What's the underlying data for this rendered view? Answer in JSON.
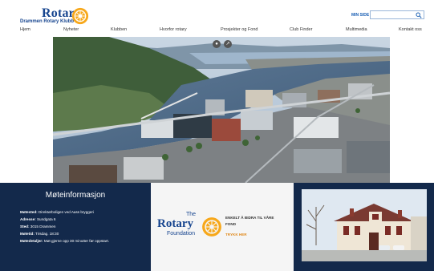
{
  "header": {
    "logo_word": "Rotary",
    "logo_club": "Drammen Rotary Klubb",
    "minside_label": "MIN SIDE",
    "search_placeholder": ""
  },
  "nav": {
    "items": [
      "Hjem",
      "Nyheter",
      "Klubben",
      "Hvorfor rotary",
      "Prosjekter og Fond",
      "Club Finder",
      "Multimedia",
      "Kontakt oss"
    ]
  },
  "hero": {
    "social_icons": [
      "photo-icon",
      "share-icon"
    ]
  },
  "meeting": {
    "title": "Møteinformasjon",
    "rows": [
      {
        "label": "Møtested:",
        "value": " Direktørboligen ved Aass bryggeri"
      },
      {
        "label": "Adresse:",
        "value": " Sundgata 6"
      },
      {
        "label": "Sted:",
        "value": " 3015 Drammen"
      },
      {
        "label": "Møtetid:",
        "value": " Tirsdag. 18:30"
      },
      {
        "label": "Møtedetaljer:",
        "value": " Møt gjerne opp 30 minutter før oppstart."
      }
    ]
  },
  "foundation": {
    "the": "The",
    "rotary": "Rotary",
    "foundation": "Foundation",
    "text_line1": "ENKELT Å BIDRA TIL VÅRE",
    "text_line2": "FOND",
    "cta": "TRYKK HER"
  },
  "colors": {
    "brand_blue": "#17458f",
    "navy": "#13294b",
    "gold": "#f7a81b",
    "cta_orange": "#e08a1e"
  }
}
